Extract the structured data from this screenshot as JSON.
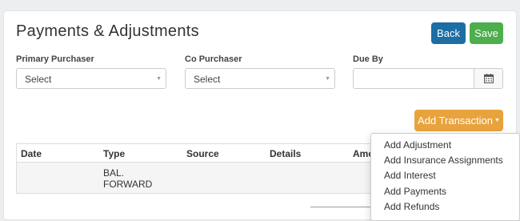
{
  "page": {
    "title": "Payments & Adjustments",
    "back_label": "Back",
    "save_label": "Save"
  },
  "form": {
    "primary_purchaser": {
      "label": "Primary Purchaser",
      "value": "Select"
    },
    "co_purchaser": {
      "label": "Co Purchaser",
      "value": "Select"
    },
    "due_by": {
      "label": "Due By",
      "value": ""
    }
  },
  "actions": {
    "add_transaction_label": "Add Transaction"
  },
  "table": {
    "headers": [
      "Date",
      "Type",
      "Source",
      "Details",
      "Amo"
    ],
    "rows": [
      {
        "date": "",
        "type_line1": "BAL.",
        "type_line2": "FORWARD",
        "source": "",
        "details": ""
      }
    ]
  },
  "dropdown": {
    "items": [
      "Add Adjustment",
      "Add Insurance Assignments",
      "Add Interest",
      "Add Payments",
      "Add Refunds"
    ]
  },
  "colors": {
    "back_button": "#1c6ea4",
    "save_button": "#4cae4c",
    "add_transaction_button": "#e8a33d"
  },
  "icons": {
    "calendar": "calendar-icon",
    "select_caret": "caret-down-icon"
  }
}
